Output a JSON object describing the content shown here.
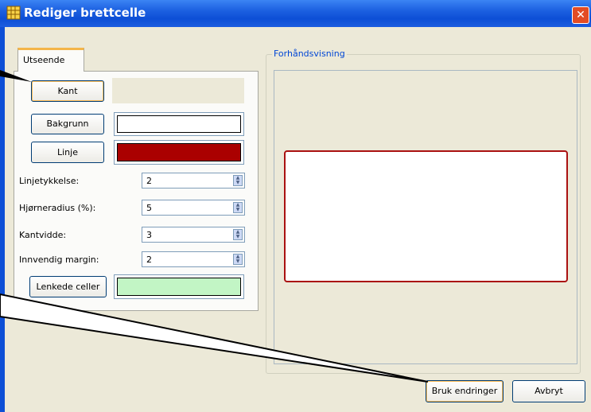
{
  "window": {
    "title": "Rediger brettcelle",
    "icon": "grid-app-icon",
    "close_icon": "close-icon"
  },
  "tabs": [
    {
      "label": "Utseende",
      "selected": true
    }
  ],
  "appearance": {
    "kant_label": "Kant",
    "bakgrunn_label": "Bakgrunn",
    "bakgrunn_color": "#ffffff",
    "linje_label": "Linje",
    "linje_color": "#aa0000",
    "fields": [
      {
        "label": "Linjetykkelse:",
        "value": "2"
      },
      {
        "label": "Hjørneradius (%):",
        "value": "5"
      },
      {
        "label": "Kantvidde:",
        "value": "3"
      },
      {
        "label": "Innvendig margin:",
        "value": "2"
      }
    ],
    "lenkede_label": "Lenkede celler",
    "lenkede_color": "#c2f5c5"
  },
  "preview": {
    "label": "Forhåndsvisning",
    "cell_border_color": "#aa1111"
  },
  "buttons": {
    "apply": "Bruk endringer",
    "cancel": "Avbryt"
  }
}
